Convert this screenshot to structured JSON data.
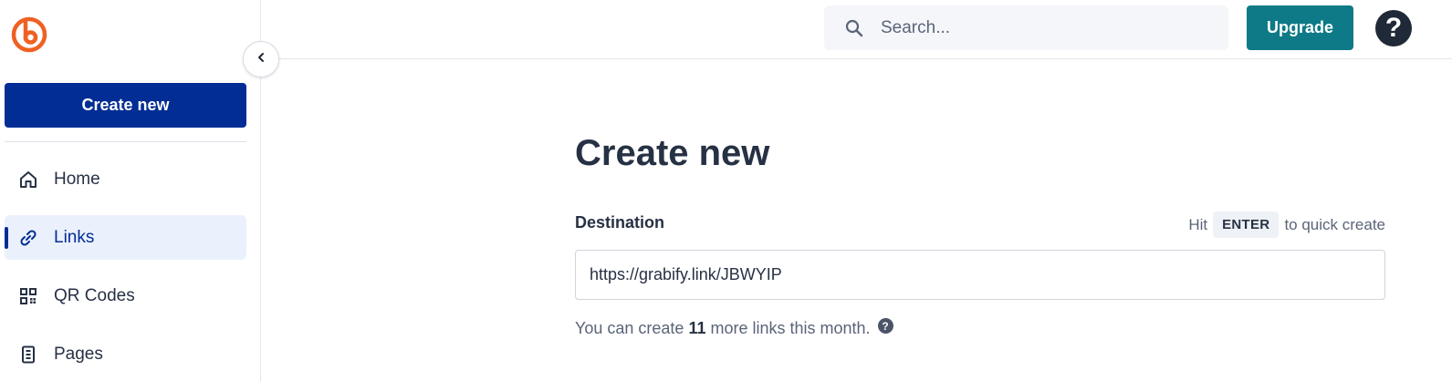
{
  "sidebar": {
    "create_label": "Create new",
    "items": [
      {
        "label": "Home",
        "icon": "home-icon"
      },
      {
        "label": "Links",
        "icon": "link-icon",
        "active": true
      },
      {
        "label": "QR Codes",
        "icon": "qr-code-icon"
      },
      {
        "label": "Pages",
        "icon": "pages-icon"
      }
    ]
  },
  "topbar": {
    "search_placeholder": "Search...",
    "upgrade_label": "Upgrade",
    "help_label": "?"
  },
  "main": {
    "title": "Create new",
    "destination_label": "Destination",
    "hint_prefix": "Hit",
    "hint_key": "ENTER",
    "hint_suffix": "to quick create",
    "destination_value": "https://grabify.link/JBWYIP",
    "limit_prefix": "You can create",
    "limit_count": "11",
    "limit_suffix": "more links this month.",
    "limit_help": "?"
  },
  "colors": {
    "brand_orange": "#ee6123",
    "primary_blue": "#022d94",
    "upgrade_teal": "#0e7a87",
    "active_bg": "#ebf1fc"
  }
}
